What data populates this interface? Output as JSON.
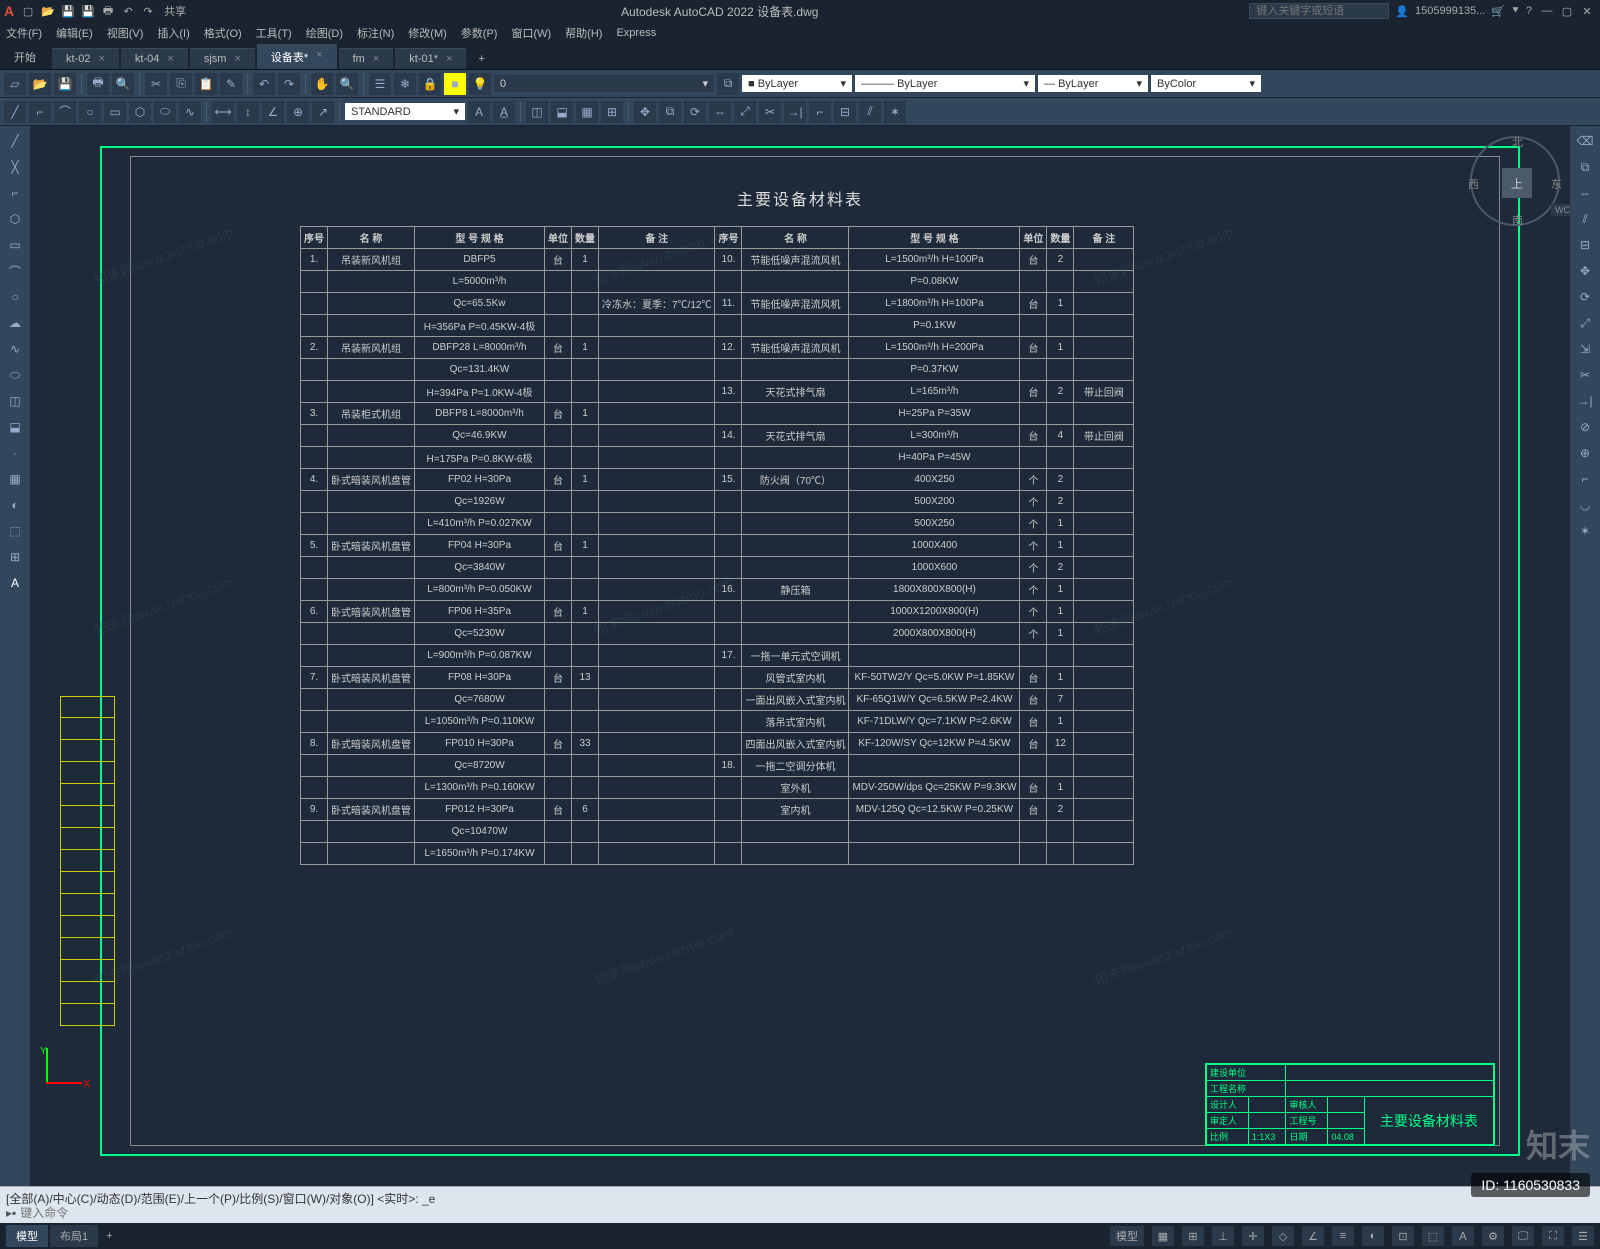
{
  "app": {
    "logo": "A",
    "title": "Autodesk AutoCAD 2022   设备表.dwg",
    "search_ph": "键入关键字或短语",
    "user": "1505999135...",
    "share": "共享"
  },
  "menus": [
    "文件(F)",
    "编辑(E)",
    "视图(V)",
    "插入(I)",
    "格式(O)",
    "工具(T)",
    "绘图(D)",
    "标注(N)",
    "修改(M)",
    "参数(P)",
    "窗口(W)",
    "帮助(H)",
    "Express"
  ],
  "filetabs": {
    "start": "开始",
    "items": [
      "kt-02",
      "kt-04",
      "sjsm",
      "设备表*",
      "fm",
      "kt-01*"
    ],
    "active_index": 3
  },
  "layer_row": {
    "layer_val": "0",
    "style": "STANDARD",
    "bylayer1": "ByLayer",
    "bylayer2": "ByLayer",
    "bylayer3": "ByLayer",
    "bycolor": "ByColor"
  },
  "sheet": {
    "title": "主要设备材料表",
    "headers": [
      "序号",
      "名 称",
      "型 号 规 格",
      "单位",
      "数量",
      "备 注"
    ],
    "left_rows": [
      [
        "1.",
        "吊装新风机组",
        "DBFP5",
        "台",
        "1",
        ""
      ],
      [
        "",
        "",
        "L=5000m³/h",
        "",
        "",
        ""
      ],
      [
        "",
        "",
        "Qc=65.5Kw",
        "",
        "",
        "冷冻水：夏季：7℃/12℃"
      ],
      [
        "",
        "",
        "H=356Pa   P=0.45KW-4极",
        "",
        "",
        ""
      ],
      [
        "2.",
        "吊装新风机组",
        "DBFP28    L=8000m³/h",
        "台",
        "1",
        ""
      ],
      [
        "",
        "",
        "Qc=131.4KW",
        "",
        "",
        ""
      ],
      [
        "",
        "",
        "H=394Pa   P=1.0KW-4极",
        "",
        "",
        ""
      ],
      [
        "3.",
        "吊装柜式机组",
        "DBFP8    L=8000m³/h",
        "台",
        "1",
        ""
      ],
      [
        "",
        "",
        "Qc=46.9KW",
        "",
        "",
        ""
      ],
      [
        "",
        "",
        "H=175Pa   P=0.8KW-6极",
        "",
        "",
        ""
      ],
      [
        "4.",
        "卧式暗装风机盘管",
        "FP02      H=30Pa",
        "台",
        "1",
        ""
      ],
      [
        "",
        "",
        "Qc=1926W",
        "",
        "",
        ""
      ],
      [
        "",
        "",
        "L=410m³/h   P=0.027KW",
        "",
        "",
        ""
      ],
      [
        "5.",
        "卧式暗装风机盘管",
        "FP04      H=30Pa",
        "台",
        "1",
        ""
      ],
      [
        "",
        "",
        "Qc=3840W",
        "",
        "",
        ""
      ],
      [
        "",
        "",
        "L=800m³/h   P=0.050KW",
        "",
        "",
        ""
      ],
      [
        "6.",
        "卧式暗装风机盘管",
        "FP06      H=35Pa",
        "台",
        "1",
        ""
      ],
      [
        "",
        "",
        "Qc=5230W",
        "",
        "",
        ""
      ],
      [
        "",
        "",
        "L=900m³/h   P=0.087KW",
        "",
        "",
        ""
      ],
      [
        "7.",
        "卧式暗装风机盘管",
        "FP08      H=30Pa",
        "台",
        "13",
        ""
      ],
      [
        "",
        "",
        "Qc=7680W",
        "",
        "",
        ""
      ],
      [
        "",
        "",
        "L=1050m³/h   P=0.110KW",
        "",
        "",
        ""
      ],
      [
        "8.",
        "卧式暗装风机盘管",
        "FP010      H=30Pa",
        "台",
        "33",
        ""
      ],
      [
        "",
        "",
        "Qc=8720W",
        "",
        "",
        ""
      ],
      [
        "",
        "",
        "L=1300m³/h   P=0.160KW",
        "",
        "",
        ""
      ],
      [
        "9.",
        "卧式暗装风机盘管",
        "FP012      H=30Pa",
        "台",
        "6",
        ""
      ],
      [
        "",
        "",
        "Qc=10470W",
        "",
        "",
        ""
      ],
      [
        "",
        "",
        "L=1650m³/h   P=0.174KW",
        "",
        "",
        ""
      ]
    ],
    "right_rows": [
      [
        "10.",
        "节能低噪声混流风机",
        "L=1500m³/h   H=100Pa",
        "台",
        "2",
        ""
      ],
      [
        "",
        "",
        "P=0.08KW",
        "",
        "",
        ""
      ],
      [
        "11.",
        "节能低噪声混流风机",
        "L=1800m³/h   H=100Pa",
        "台",
        "1",
        ""
      ],
      [
        "",
        "",
        "P=0.1KW",
        "",
        "",
        ""
      ],
      [
        "12.",
        "节能低噪声混流风机",
        "L=1500m³/h   H=200Pa",
        "台",
        "1",
        ""
      ],
      [
        "",
        "",
        "P=0.37KW",
        "",
        "",
        ""
      ],
      [
        "13.",
        "天花式排气扇",
        "L=165m³/h",
        "台",
        "2",
        "带止回阀"
      ],
      [
        "",
        "",
        "H=25Pa   P=35W",
        "",
        "",
        ""
      ],
      [
        "14.",
        "天花式排气扇",
        "L=300m³/h",
        "台",
        "4",
        "带止回阀"
      ],
      [
        "",
        "",
        "H=40Pa   P=45W",
        "",
        "",
        ""
      ],
      [
        "15.",
        "防火阀（70℃）",
        "400X250",
        "个",
        "2",
        ""
      ],
      [
        "",
        "",
        "500X200",
        "个",
        "2",
        ""
      ],
      [
        "",
        "",
        "500X250",
        "个",
        "1",
        ""
      ],
      [
        "",
        "",
        "1000X400",
        "个",
        "1",
        ""
      ],
      [
        "",
        "",
        "1000X600",
        "个",
        "2",
        ""
      ],
      [
        "16.",
        "静压箱",
        "1800X800X800(H)",
        "个",
        "1",
        ""
      ],
      [
        "",
        "",
        "1000X1200X800(H)",
        "个",
        "1",
        ""
      ],
      [
        "",
        "",
        "2000X800X800(H)",
        "个",
        "1",
        ""
      ],
      [
        "17.",
        "一拖一单元式空调机",
        "",
        "",
        "",
        ""
      ],
      [
        "",
        "风管式室内机",
        "KF-50TW2/Y   Qc=5.0KW P=1.85KW",
        "台",
        "1",
        ""
      ],
      [
        "",
        "一面出风嵌入式室内机",
        "KF-65Q1W/Y   Qc=6.5KW P=2.4KW",
        "台",
        "7",
        ""
      ],
      [
        "",
        "落吊式室内机",
        "KF-71DLW/Y   Qc=7.1KW P=2.6KW",
        "台",
        "1",
        ""
      ],
      [
        "",
        "四面出风嵌入式室内机",
        "KF-120W/SY   Qc=12KW P=4.5KW",
        "台",
        "12",
        ""
      ],
      [
        "18.",
        "一拖二空调分体机",
        "",
        "",
        "",
        ""
      ],
      [
        "",
        "室外机",
        "MDV-250W/dps  Qc=25KW P=9.3KW",
        "台",
        "1",
        ""
      ],
      [
        "",
        "室内机",
        "MDV-125Q   Qc=12.5KW P=0.25KW",
        "台",
        "2",
        ""
      ],
      [
        "",
        "",
        "",
        "",
        "",
        ""
      ]
    ]
  },
  "title_block": {
    "row1": [
      "建设单位",
      "",
      "工程名称",
      ""
    ],
    "design_label": "设计人",
    "check_label": "审核人",
    "approve_label": "审定人",
    "proj": "工程号",
    "scale": "比例",
    "date": "日期",
    "drawing_name": "主要设备材料表",
    "scale_val": "1:1X3",
    "date_val": "04.08"
  },
  "view_cube": {
    "n": "北",
    "s": "南",
    "e": "东",
    "w": "西",
    "top": "上",
    "wcs": "WCS"
  },
  "cmd": {
    "history": "[全部(A)/中心(C)/动态(D)/范围(E)/上一个(P)/比例(S)/窗口(W)/对象(O)] <实时>: _e",
    "prompt": "键入命令"
  },
  "status": {
    "layouts": [
      "模型",
      "布局1"
    ],
    "active": 0,
    "label_model": "模型"
  },
  "watermark": "知末网www.znzmo.com",
  "id_badge": "ID: 1160530833",
  "zhimo": "知末"
}
